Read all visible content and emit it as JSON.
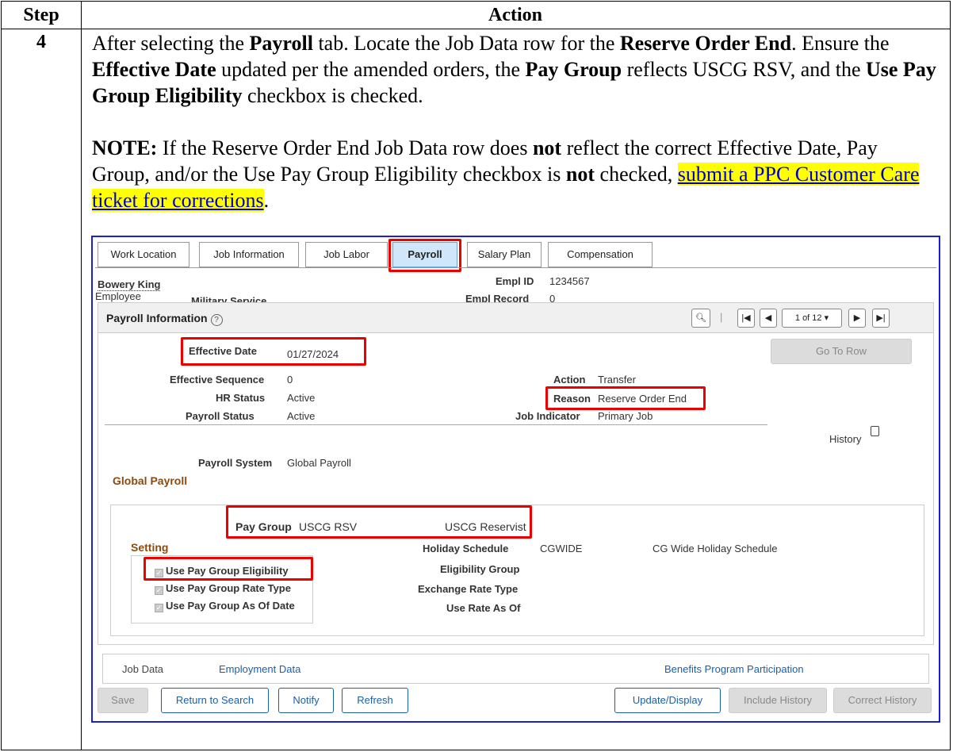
{
  "table": {
    "header_step": "Step",
    "header_action": "Action",
    "step_number": "4"
  },
  "instruction": {
    "p1_a": "After selecting the ",
    "p1_b": "Payroll",
    "p1_c": " tab. Locate the Job Data row for the ",
    "p1_d": "Reserve Order End",
    "p1_e": ". Ensure the ",
    "p1_f": "Effective Date",
    "p1_g": " updated per the amended orders, the ",
    "p1_h": "Pay Group",
    "p1_i": " reflects USCG RSV, and the ",
    "p1_j": "Use Pay Group Eligibility",
    "p1_k": " checkbox is checked.",
    "note_label": "NOTE:",
    "note_a": " If the Reserve Order End Job Data row does ",
    "note_b": "not",
    "note_c": " reflect the correct Effective Date, Pay Group, and/or the Use Pay Group Eligibility checkbox is ",
    "note_d": "not",
    "note_e": " checked, ",
    "note_link": "submit a PPC Customer Care ticket for corrections",
    "note_f": "."
  },
  "tabs": [
    "Work Location",
    "Job Information",
    "Job Labor",
    "Payroll",
    "Salary Plan",
    "Compensation"
  ],
  "header": {
    "name": "Bowery King",
    "employee_label": "Employee",
    "service": "Military Service",
    "empl_id_label": "Empl ID",
    "empl_id": "1234567",
    "empl_record_label": "Empl Record",
    "empl_record": "0"
  },
  "payroll_info": {
    "title": "Payroll Information",
    "help_icon": "?",
    "pager": "1 of 12",
    "go_to_row": "Go To Row",
    "effective_date_label": "Effective Date",
    "effective_date": "01/27/2024",
    "effective_seq_label": "Effective Sequence",
    "effective_seq": "0",
    "hr_status_label": "HR Status",
    "hr_status": "Active",
    "payroll_status_label": "Payroll Status",
    "payroll_status": "Active",
    "action_label": "Action",
    "action": "Transfer",
    "reason_label": "Reason",
    "reason": "Reserve Order End",
    "job_indicator_label": "Job Indicator",
    "job_indicator": "Primary Job",
    "history_label": "History",
    "payroll_system_label": "Payroll System",
    "payroll_system": "Global Payroll",
    "global_payroll_title": "Global Payroll",
    "pay_group_label": "Pay Group",
    "pay_group": "USCG RSV",
    "pay_group_desc": "USCG Reservist",
    "setting_title": "Setting",
    "cb_eligibility": "Use Pay Group Eligibility",
    "cb_rate_type": "Use Pay Group Rate Type",
    "cb_as_of_date": "Use Pay Group As Of Date",
    "holiday_label": "Holiday Schedule",
    "holiday": "CGWIDE",
    "holiday_desc": "CG Wide Holiday Schedule",
    "elig_group_label": "Eligibility Group",
    "exchange_rate_label": "Exchange Rate Type",
    "use_rate_label": "Use Rate As Of"
  },
  "links": {
    "job_data": "Job Data",
    "employment_data": "Employment Data",
    "benefits": "Benefits Program Participation"
  },
  "buttons": {
    "save": "Save",
    "return_to_search": "Return to Search",
    "notify": "Notify",
    "refresh": "Refresh",
    "update_display": "Update/Display",
    "include_history": "Include History",
    "correct_history": "Correct History"
  }
}
